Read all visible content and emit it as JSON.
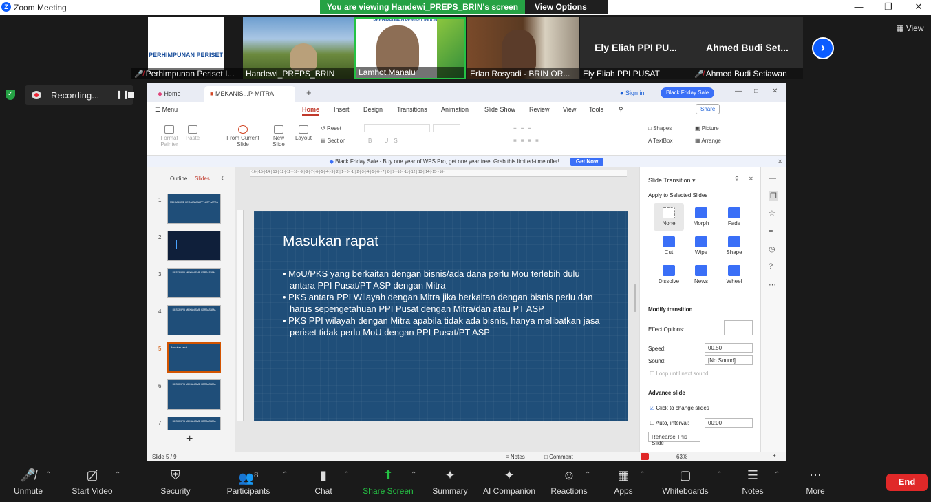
{
  "window": {
    "title": "Zoom Meeting"
  },
  "share_bar": {
    "viewing_text": "You are viewing Handewi_PREPS_BRIN's screen",
    "view_options": "View Options"
  },
  "participants": [
    {
      "name": "Perhimpunan Periset I...",
      "muted": true,
      "logo_text": "PERHIMPUNAN PERISET"
    },
    {
      "name": "Handewi_PREPS_BRIN",
      "muted": false
    },
    {
      "name": "Lamhot Manalu",
      "muted": false,
      "logo_text": "PERHIMPUNAN PERISET INDONESIA"
    },
    {
      "name": "Erlan Rosyadi - BRIN OR...",
      "muted": false
    },
    {
      "name": "Ely Eliah  PPI PUSAT",
      "muted": false,
      "big_name": "Ely Eliah  PPI PU..."
    },
    {
      "name": "Ahmed Budi Setiawan",
      "muted": true,
      "big_name": "Ahmed Budi Set..."
    }
  ],
  "view_button": "View",
  "recording": {
    "label": "Recording..."
  },
  "wps": {
    "tabs": [
      "Home",
      "MEKANIS...P-MITRA"
    ],
    "sign_in": "Sign in",
    "promo_button": "Black Friday Sale",
    "share": "Share",
    "menu": [
      "Menu",
      "Home",
      "Insert",
      "Design",
      "Transitions",
      "Animation",
      "Slide Show",
      "Review",
      "View",
      "Tools"
    ],
    "ribbon": {
      "format_painter": "Format Painter",
      "paste": "Paste",
      "from_current_slide": "From Current Slide",
      "new_slide": "New Slide",
      "layout": "Layout",
      "reset": "Reset",
      "section": "Section",
      "shapes": "Shapes",
      "picture": "Picture",
      "textbox": "TextBox",
      "arrange": "Arrange"
    },
    "banner": {
      "text": "Black Friday Sale · Buy one year of WPS Pro, get one year free! Grab this limited-time offer!",
      "button": "Get Now"
    },
    "slide_panel": {
      "outline": "Outline",
      "slides": "Slides",
      "numbers": [
        "1",
        "2",
        "3",
        "4",
        "5",
        "6",
        "7"
      ],
      "current": "5"
    },
    "slide": {
      "title": "Masukan rapat",
      "bullets": [
        "MoU/PKS  yang berkaitan dengan bisnis/ada dana perlu Mou terlebih dulu antara PPI Pusat/PT ASP dengan Mitra",
        "PKS antara PPI Wilayah dengan Mitra jika berkaitan dengan bisnis perlu dan harus sepengetahuan PPI Pusat dengan Mitra/dan atau PT ASP",
        "PKS PPI wilayah dengan Mitra apabila tidak ada bisnis, hanya melibatkan jasa periset tidak perlu MoU dengan PPI Pusat/PT ASP"
      ]
    },
    "transition_pane": {
      "title": "Slide Transition",
      "apply_to": "Apply to Selected Slides",
      "effects": [
        "None",
        "Morph",
        "Fade",
        "Cut",
        "Wipe",
        "Shape",
        "Dissolve",
        "News",
        "Wheel"
      ],
      "selected": "None",
      "modify": "Modify transition",
      "effect_options": "Effect Options:",
      "speed_label": "Speed:",
      "speed_value": "00.50",
      "sound_label": "Sound:",
      "sound_value": "[No Sound]",
      "loop": "Loop until next sound",
      "advance": "Advance slide",
      "click_to_change": "Click to change slides",
      "auto_interval": "Auto, interval:",
      "interval_value": "00:00",
      "rehearse": "Rehearse This Slide"
    },
    "status": {
      "slide_of": "Slide 5 / 9",
      "notes": "Notes",
      "comment": "Comment",
      "zoom": "63%"
    }
  },
  "toolbar": {
    "unmute": "Unmute",
    "start_video": "Start Video",
    "security": "Security",
    "participants": "Participants",
    "participants_count": "8",
    "chat": "Chat",
    "share_screen": "Share Screen",
    "summary": "Summary",
    "ai_companion": "AI Companion",
    "reactions": "Reactions",
    "apps": "Apps",
    "whiteboards": "Whiteboards",
    "notes": "Notes",
    "more": "More",
    "end": "End"
  }
}
